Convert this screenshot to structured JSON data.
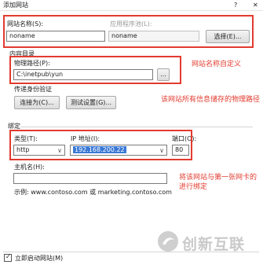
{
  "window": {
    "title": "添加网站",
    "help_icon": "?",
    "close_icon": "✕"
  },
  "site": {
    "name_label": "网站名称(S):",
    "name_value": "noname",
    "apppool_label": "应用程序池(L):",
    "apppool_value": "noname",
    "select_button": "选择(E)..."
  },
  "content": {
    "section_label": "内容目录",
    "physical_path_label": "物理路径(P):",
    "physical_path_value": "C:\\inetpub\\yun",
    "browse_button": "...",
    "pass_auth_label": "传递身份验证",
    "connect_as_button": "连接为(C)...",
    "test_settings_button": "测试设置(G)..."
  },
  "binding": {
    "section_label": "绑定",
    "type_label": "类型(T):",
    "type_value": "http",
    "ip_label": "IP 地址(I):",
    "ip_value": "192.168.200.22",
    "port_label": "端口(O):",
    "port_value": "80",
    "hostname_label": "主机名(H):",
    "hostname_value": "",
    "example_text": "示例: www.contoso.com 或 marketing.contoso.com"
  },
  "footer": {
    "autostart_label": "立即启动网站(M)",
    "autostart_checked": true
  },
  "annotations": {
    "site_name_note": "网站名称自定义",
    "physical_path_note": "该网站所有信息储存的物理路径",
    "binding_note_line1": "将该网站与第一张网卡的",
    "binding_note_line2": "进行绑定"
  },
  "watermark": {
    "text": "创新互联",
    "icon": "brand-swirl-icon"
  },
  "colors": {
    "annotation_red": "#e23b2f",
    "selection_blue": "#3a78d6",
    "watermark_gray": "#c9c9c9"
  }
}
